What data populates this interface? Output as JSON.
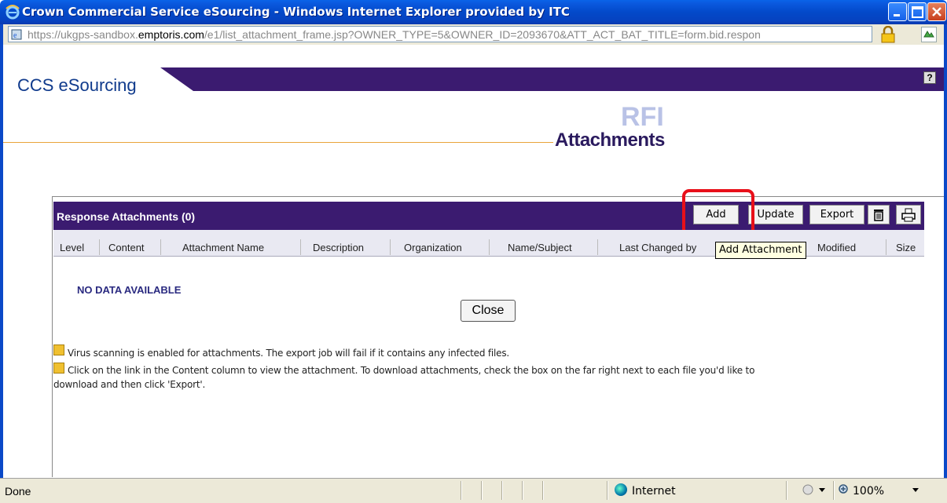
{
  "window": {
    "title": "Crown Commercial Service eSourcing - Windows Internet Explorer provided by ITC",
    "address": {
      "url_prefix": "https://ukgps-sandbox.",
      "url_domain": "emptoris.com",
      "url_rest": "/e1/list_attachment_frame.jsp?OWNER_TYPE=5&OWNER_ID=2093670&ATT_ACT_BAT_TITLE=form.bid.respon"
    }
  },
  "banner": {
    "brand": "CCS eSourcing",
    "help_label": "?"
  },
  "page": {
    "superscript": "RFI",
    "heading": "Attachments"
  },
  "table": {
    "title": "Response Attachments (0)",
    "buttons": {
      "add": "Add",
      "update": "Update",
      "export": "Export"
    },
    "columns": [
      "Level",
      "Content",
      "Attachment Name",
      "Description",
      "Organization",
      "Name/Subject",
      "Last Changed by",
      "Modified",
      "Size"
    ],
    "tooltip": "Add Attachment",
    "empty_message": "NO DATA AVAILABLE",
    "close_label": "Close"
  },
  "notes": [
    "Virus scanning is enabled for attachments. The export job will fail if it contains any infected files.",
    "Click on the link in the Content column to view the attachment. To download attachments, check the box on the far right next to each file you'd like to",
    "download and then click 'Export'."
  ],
  "status": {
    "left": "Done",
    "zone": "Internet",
    "zoom": "100%"
  },
  "colors": {
    "titlebar": "#0349c9",
    "banner": "#3b1b70",
    "heading_line": "#e9a43a",
    "highlight": "#e8101a"
  }
}
